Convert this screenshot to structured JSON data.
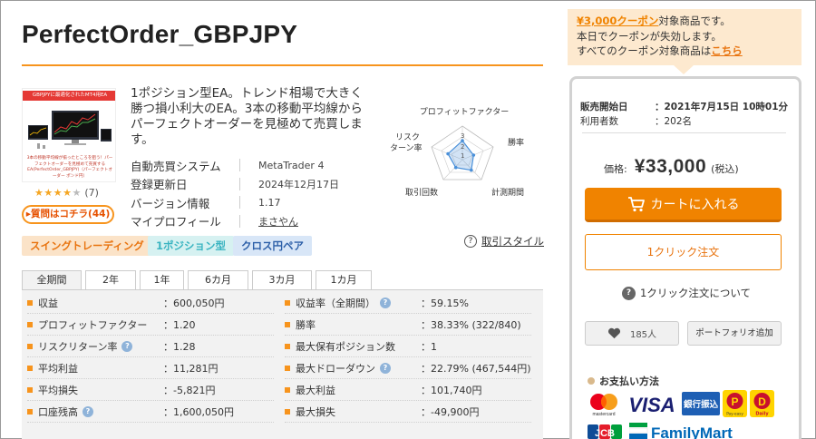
{
  "product": {
    "title": "PerfectOrder_GBPJPY",
    "thumb_banner": "GBPJPYに最適化されたMT4用EA",
    "thumb_text": "3本の移動平均線が揃ったところを狙う！パーフェクトオーダーを見極めて売買するEA(PerfectOrder_GBPJPY)（パーフェクトオーダー ポンド円）",
    "rating_count": "(7)",
    "question_button": "質問はコチラ(44)",
    "description": "1ポジション型EA。トレンド相場で大きく勝つ損小利大のEA。3本の移動平均線からパーフェクトオーダーを見極めて売買します。"
  },
  "specs": [
    {
      "label": "自動売買システム",
      "value": "MetaTrader 4"
    },
    {
      "label": "登録更新日",
      "value": "2024年12月17日"
    },
    {
      "label": "バージョン情報",
      "value": "1.17"
    },
    {
      "label": "マイプロフィール",
      "value": "まさやん"
    }
  ],
  "radar": {
    "labels": [
      "プロフィットファクター",
      "勝率",
      "計測期間",
      "取引回数",
      "リスク",
      "ターン率"
    ],
    "inner_labels": [
      "3",
      "2",
      "1"
    ],
    "values": [
      0.55,
      0.35,
      0.4,
      0.3,
      0.45
    ],
    "color": "#4a90d9"
  },
  "tags": [
    "スイングトレーディング",
    "1ポジション型",
    "クロス円ペア"
  ],
  "style_link": "取引スタイル",
  "tabs": [
    "全期間",
    "2年",
    "1年",
    "6カ月",
    "3カ月",
    "1カ月"
  ],
  "stats_left": [
    {
      "label": "収益",
      "value": "：600,050円"
    },
    {
      "label": "プロフィットファクター",
      "value": "：1.20"
    },
    {
      "label": "リスクリターン率",
      "value": "：1.28"
    },
    {
      "label": "平均利益",
      "value": "：11,281円"
    },
    {
      "label": "平均損失",
      "value": "：-5,821円"
    },
    {
      "label": "口座残高",
      "value": "：1,600,050円"
    }
  ],
  "stats_right": [
    {
      "label": "収益率（全期間）",
      "value": "：59.15%"
    },
    {
      "label": "勝率",
      "value": "：38.33% (322/840)"
    },
    {
      "label": "最大保有ポジション数",
      "value": "：1"
    },
    {
      "label": "最大ドローダウン",
      "value": "：22.79% (467,544円)"
    },
    {
      "label": "最大利益",
      "value": "：101,740円"
    },
    {
      "label": "最大損失",
      "value": "：-49,900円"
    }
  ],
  "coupon": {
    "amount": "¥3,000クーポン",
    "line1_rest": "対象商品です。",
    "line2": "本日でクーポンが失効します。",
    "line3_pre": "すべてのクーポン対象商品は",
    "link": "こちら"
  },
  "sidebar": {
    "sale_start_label": "販売開始日",
    "sale_start_value": "：2021年7月15日 10時01分",
    "users_label": "利用者数",
    "users_value": "：202名",
    "price_label": "価格:",
    "price_value": "¥33,000",
    "price_tax": "(税込)",
    "cart_button": "カートに入れる",
    "one_click_button": "1クリック注文",
    "one_click_about": "1クリック注文について",
    "fav_count": "185人",
    "portfolio_button": "ポートフォリオ追加",
    "payment_heading": "お支払い方法",
    "payment": {
      "mastercard": "mastercard",
      "visa": "VISA",
      "bank": "銀行振込",
      "pay_easy": "Pay-easy",
      "daily": "Daily",
      "jcb": "JCB",
      "familymart": "FamilyMart"
    }
  },
  "colors": {
    "accent": "#f7941d",
    "cart": "#f08300",
    "coupon_bg": "#fde9cf"
  }
}
